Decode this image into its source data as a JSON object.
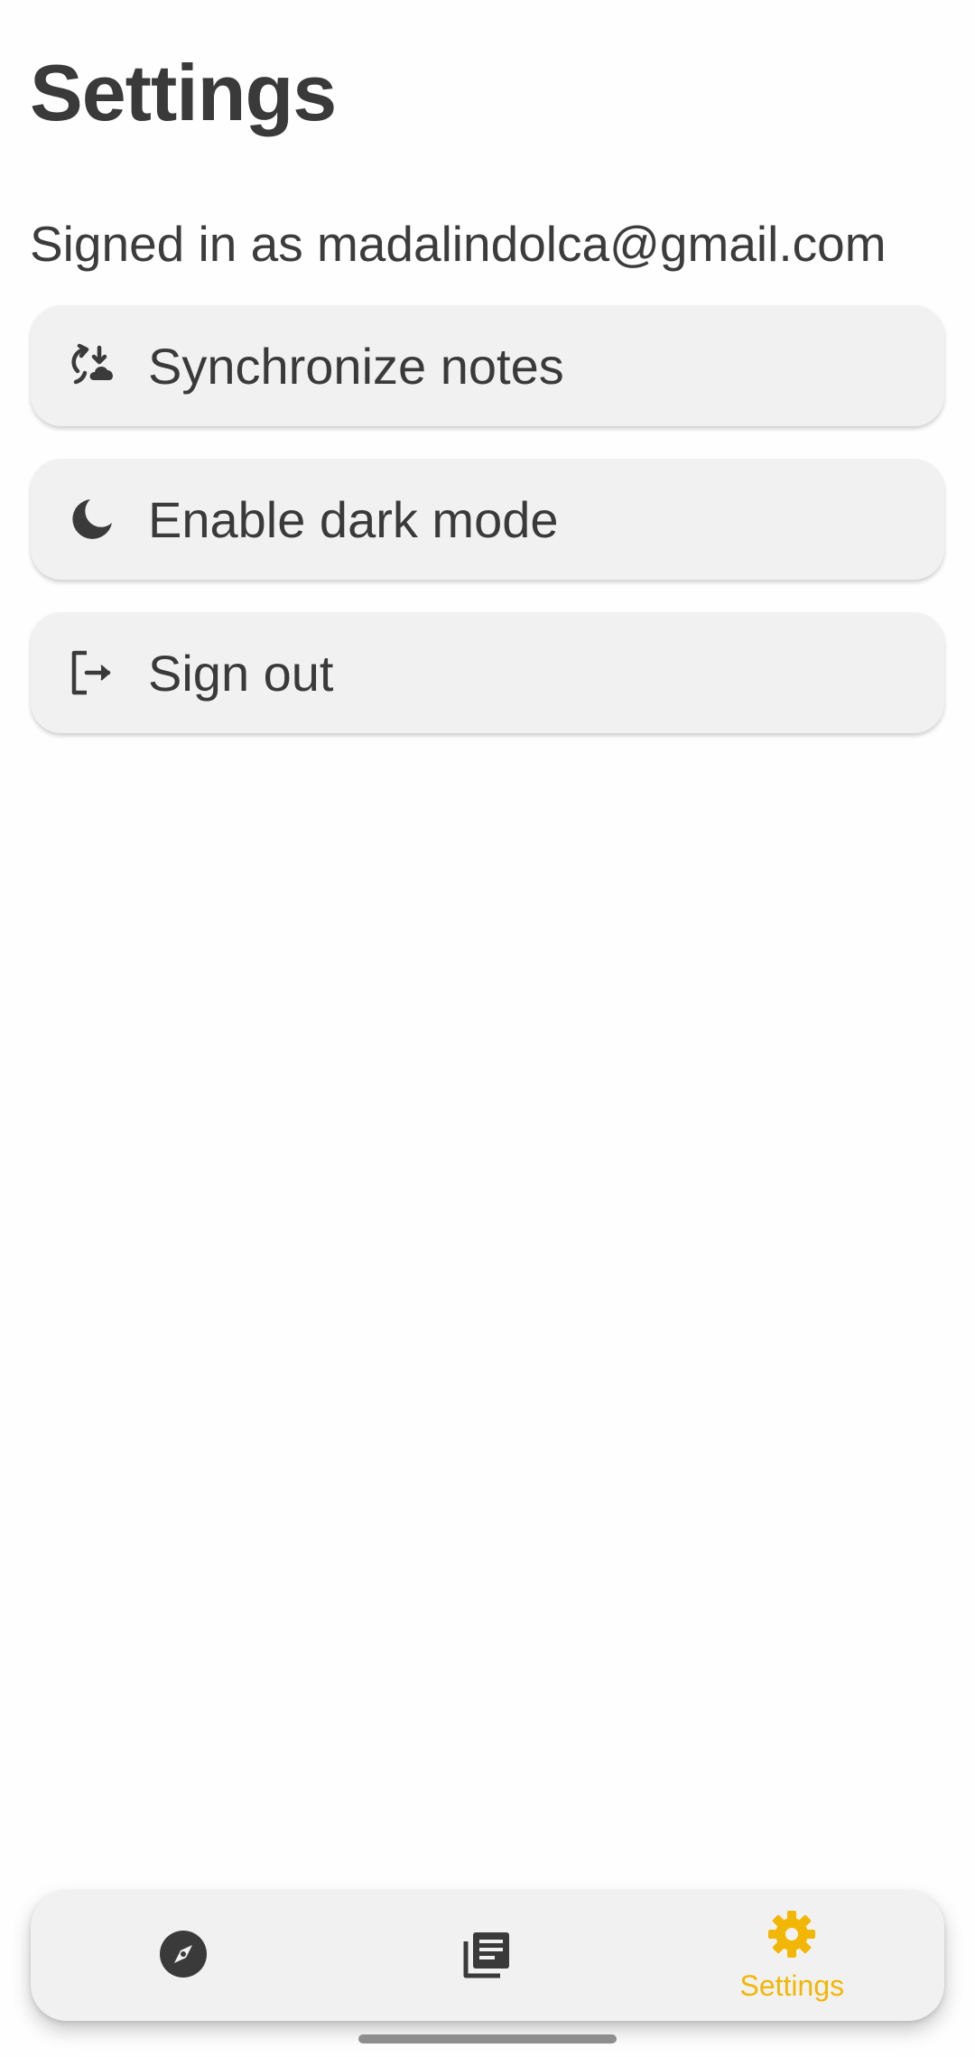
{
  "header": {
    "title": "Settings"
  },
  "account": {
    "signed_in_text": "Signed in as madalindolca@gmail.com"
  },
  "options": [
    {
      "label": "Synchronize notes",
      "icon": "sync-cloud-icon"
    },
    {
      "label": "Enable dark mode",
      "icon": "moon-icon"
    },
    {
      "label": "Sign out",
      "icon": "logout-icon"
    }
  ],
  "bottom_nav": {
    "items": [
      {
        "label": "",
        "icon": "compass-icon",
        "active": false
      },
      {
        "label": "",
        "icon": "notes-icon",
        "active": false
      },
      {
        "label": "Settings",
        "icon": "gear-icon",
        "active": true
      }
    ]
  },
  "colors": {
    "accent": "#f2b705",
    "text": "#3a3a3a",
    "card": "#f1f1f1",
    "background": "#fefefe"
  }
}
